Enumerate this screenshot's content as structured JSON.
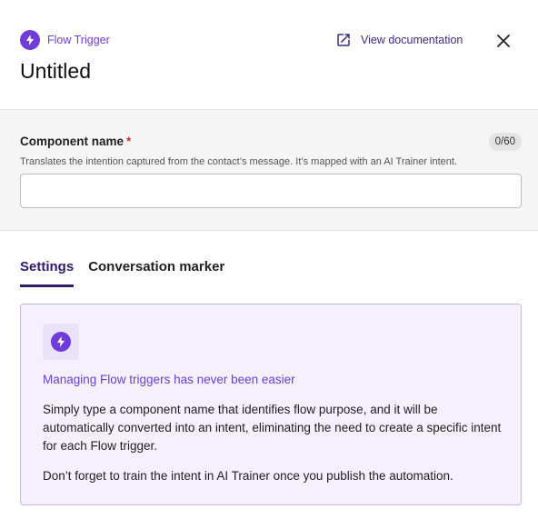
{
  "header": {
    "breadcrumb_icon": "flash-icon",
    "breadcrumb_label": "Flow Trigger",
    "doc_icon": "open-in-new-icon",
    "doc_label": "View documentation",
    "close_icon": "close-icon",
    "title": "Untitled"
  },
  "name_field": {
    "label": "Component name",
    "required_mark": "*",
    "counter": "0/60",
    "helper": "Translates the intention captured from the contact’s message. It’s mapped with an AI Trainer intent.",
    "value": "",
    "placeholder": ""
  },
  "tabs": [
    {
      "label": "Settings",
      "active": true
    },
    {
      "label": "Conversation marker",
      "active": false
    }
  ],
  "info_card": {
    "icon": "flash-icon",
    "title": "Managing Flow triggers has never been easier",
    "body": "Simply type a component name that identifies flow purpose, and it will be automatically converted into an intent, eliminating the need to create a specific intent for each Flow trigger.",
    "note": "Don’t forget to train the intent in AI Trainer once you publish the automation."
  },
  "colors": {
    "accent": "#6f3bd9",
    "accent_text": "#6b3fd6",
    "tab_active": "#2f1b6b",
    "card_bg": "#f4f0fd",
    "card_border": "#c7b6ee",
    "section_bg": "#f5f5f5",
    "required": "#d32f2f"
  }
}
